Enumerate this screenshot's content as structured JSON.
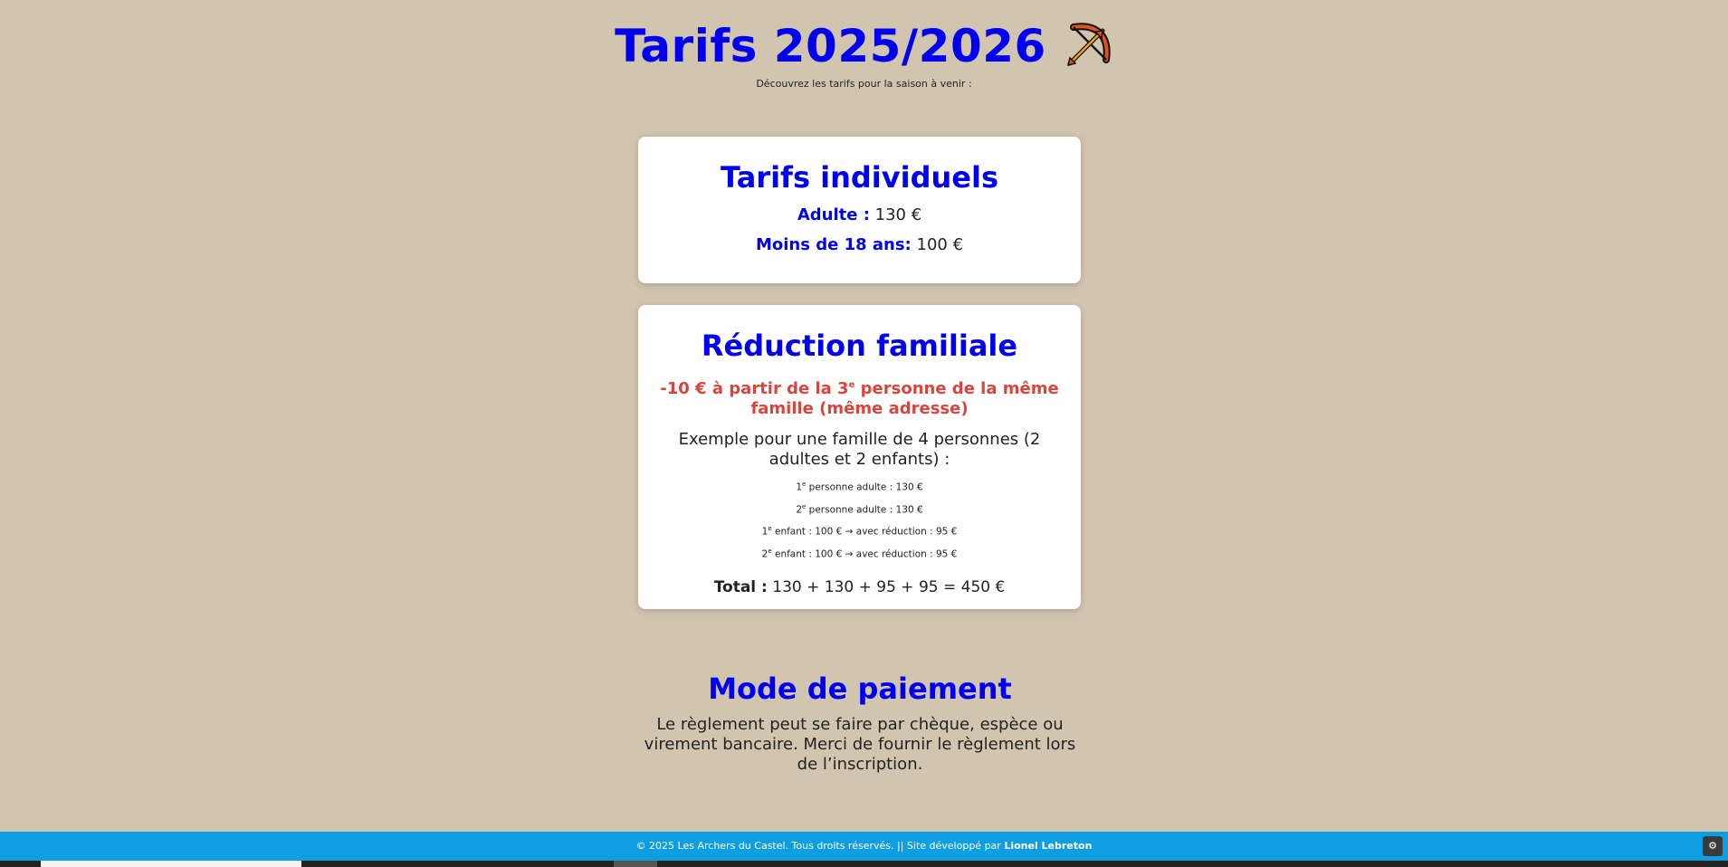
{
  "hero": {
    "title": "Tarifs 2025/2026",
    "subtitle": "Découvrez les tarifs pour la saison à venir :",
    "icon": "bow-and-arrow-icon"
  },
  "individual": {
    "title": "Tarifs individuels",
    "adult_label": "Adulte :",
    "adult_price": "130 €",
    "minor_label": "Moins de 18 ans:",
    "minor_price": "100 €"
  },
  "family": {
    "title": "Réduction familiale",
    "discount_prefix": "-10 € à partir de la 3",
    "discount_sup": "e",
    "discount_suffix": " personne de la même famille (même adresse)",
    "example": "Exemple pour une famille de 4 personnes (2 adultes et 2 enfants) :",
    "lines": [
      {
        "num": "1",
        "sup": "e",
        "text": " personne adulte : 130 €"
      },
      {
        "num": "2",
        "sup": "e",
        "text": " personne adulte : 130 €"
      },
      {
        "num": "1",
        "sup": "e",
        "text": " enfant : 100 € → avec réduction : 95 €"
      },
      {
        "num": "2",
        "sup": "e",
        "text": " enfant : 100 € → avec réduction : 95 €"
      }
    ],
    "total_label": "Total :",
    "total_value": "130 + 130 + 95 + 95 = 450 €"
  },
  "payment": {
    "title": "Mode de paiement",
    "text": "Le règlement peut se faire par chèque, espèce ou virement bancaire. Merci de fournir le règlement lors de l’inscription."
  },
  "footer": {
    "text": "© 2025 Les Archers du Castel. Tous droits réservés. || Site développé par",
    "author": "Lionel Lebreton"
  },
  "colors": {
    "background": "#d2c5b0",
    "heading": "#0000ee",
    "discount": "#d9453b",
    "footer": "#109ee3"
  }
}
